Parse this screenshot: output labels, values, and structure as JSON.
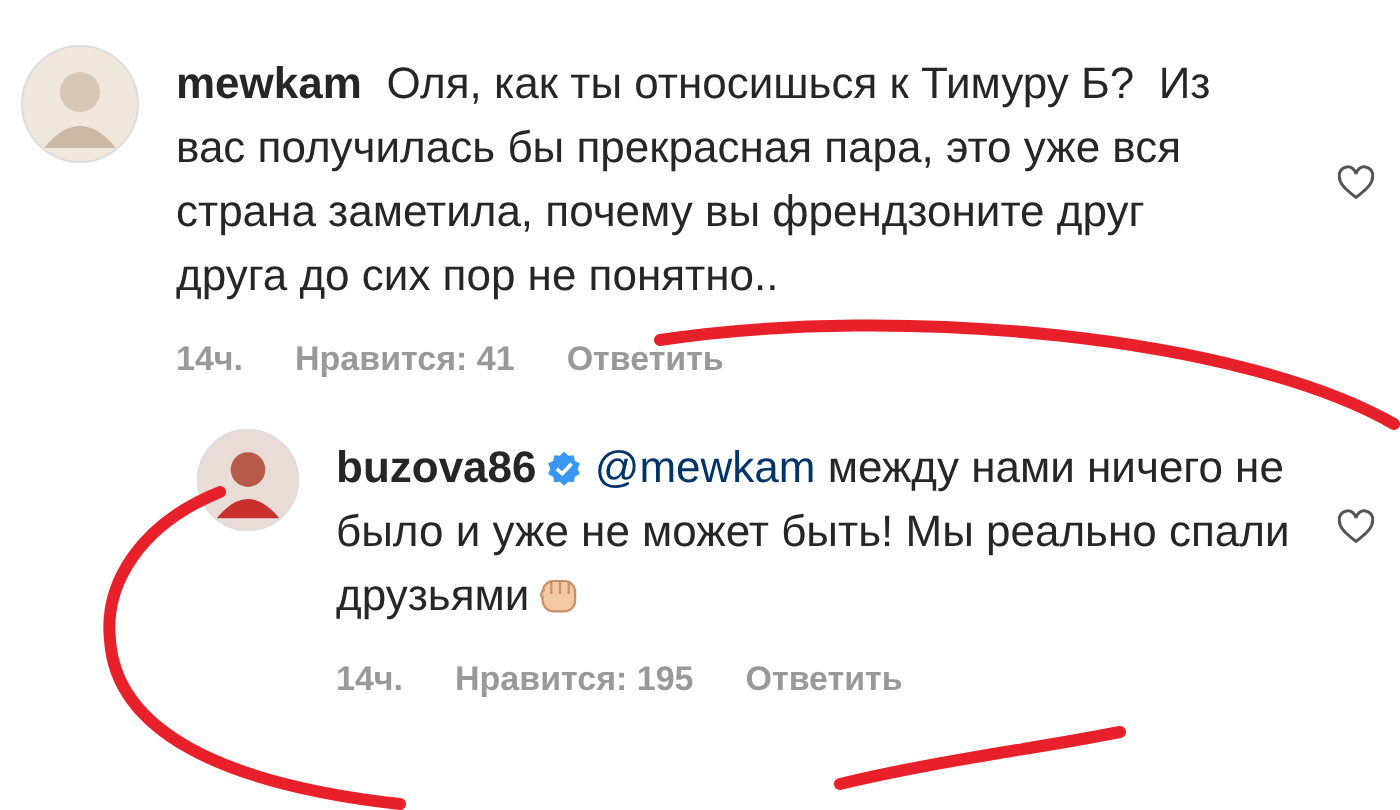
{
  "comments": [
    {
      "username": "mewkam",
      "verified": false,
      "text": "Оля, как ты относишься к Тимуру Б?  Из вас получилась бы прекрасная пара, это уже вся страна заметила, почему вы френдзоните друг друга до сих пор не понятно..",
      "emoji": false,
      "time": "14ч.",
      "likes": "Нравится: 41",
      "reply": "Ответить",
      "is_reply": false
    },
    {
      "username": "buzova86",
      "verified": true,
      "mention": "@mewkam",
      "text": "между нами ничего не было и уже не может быть! Мы реально спали друзьями",
      "emoji": true,
      "time": "14ч.",
      "likes": "Нравится: 195",
      "reply": "Ответить",
      "is_reply": true
    }
  ]
}
